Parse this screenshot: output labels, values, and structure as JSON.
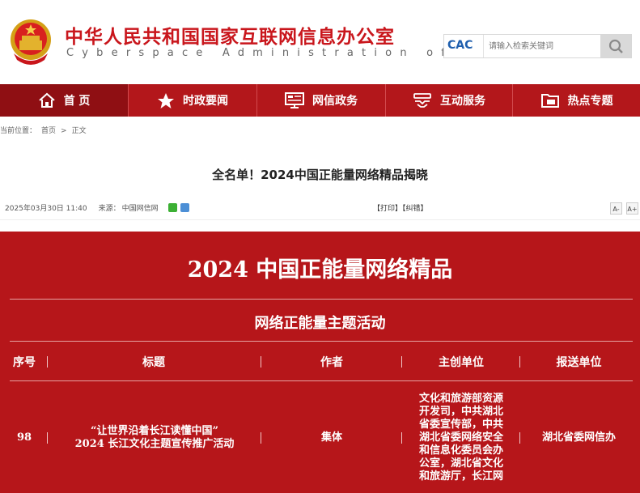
{
  "header": {
    "site_name_cn": "中华人民共和国国家互联网信息办公室",
    "site_name_en": "Cyberspace Administration of China",
    "search_logo": "CAC",
    "search_placeholder": "请输入检索关键词"
  },
  "nav": {
    "items": [
      {
        "label": "首 页",
        "icon": "home-icon"
      },
      {
        "label": "时政要闻",
        "icon": "star-icon"
      },
      {
        "label": "网信政务",
        "icon": "monitor-icon"
      },
      {
        "label": "互动服务",
        "icon": "handshake-icon"
      },
      {
        "label": "热点专题",
        "icon": "folder-icon"
      }
    ]
  },
  "breadcrumb": {
    "prefix": "当前位置：",
    "home": "首页",
    "separator": ">",
    "current": "正文"
  },
  "article": {
    "title": "全名单！2024中国正能量网络精品揭晓",
    "date": "2025年03月30日 11:40",
    "source_label": "来源：",
    "source": "中国网信网",
    "print": "【打印】",
    "correct": "【纠错】",
    "font_small": "A-",
    "font_large": "A+"
  },
  "banner": {
    "title": "2024 中国正能量网络精品",
    "subtitle": "网络正能量主题活动",
    "columns": [
      "序号",
      "标题",
      "作者",
      "主创单位",
      "报送单位"
    ],
    "rows": [
      {
        "no": "98",
        "title_lines": [
          "“让世界沿着长江读懂中国”",
          "2024 长江文化主题宣传推广活动"
        ],
        "author": "集体",
        "creator_lines": [
          "文化和旅游部资源",
          "开发司，中共湖北",
          "省委宣传部，中共",
          "湖北省委网络安全",
          "和信息化委员会办",
          "公室，湖北省文化",
          "和旅游厅，长江网"
        ],
        "submitter": "湖北省委网信办"
      }
    ]
  },
  "colors": {
    "brand_red": "#c9161c",
    "nav_red": "#b3171b",
    "banner_red": "#b6161a"
  }
}
